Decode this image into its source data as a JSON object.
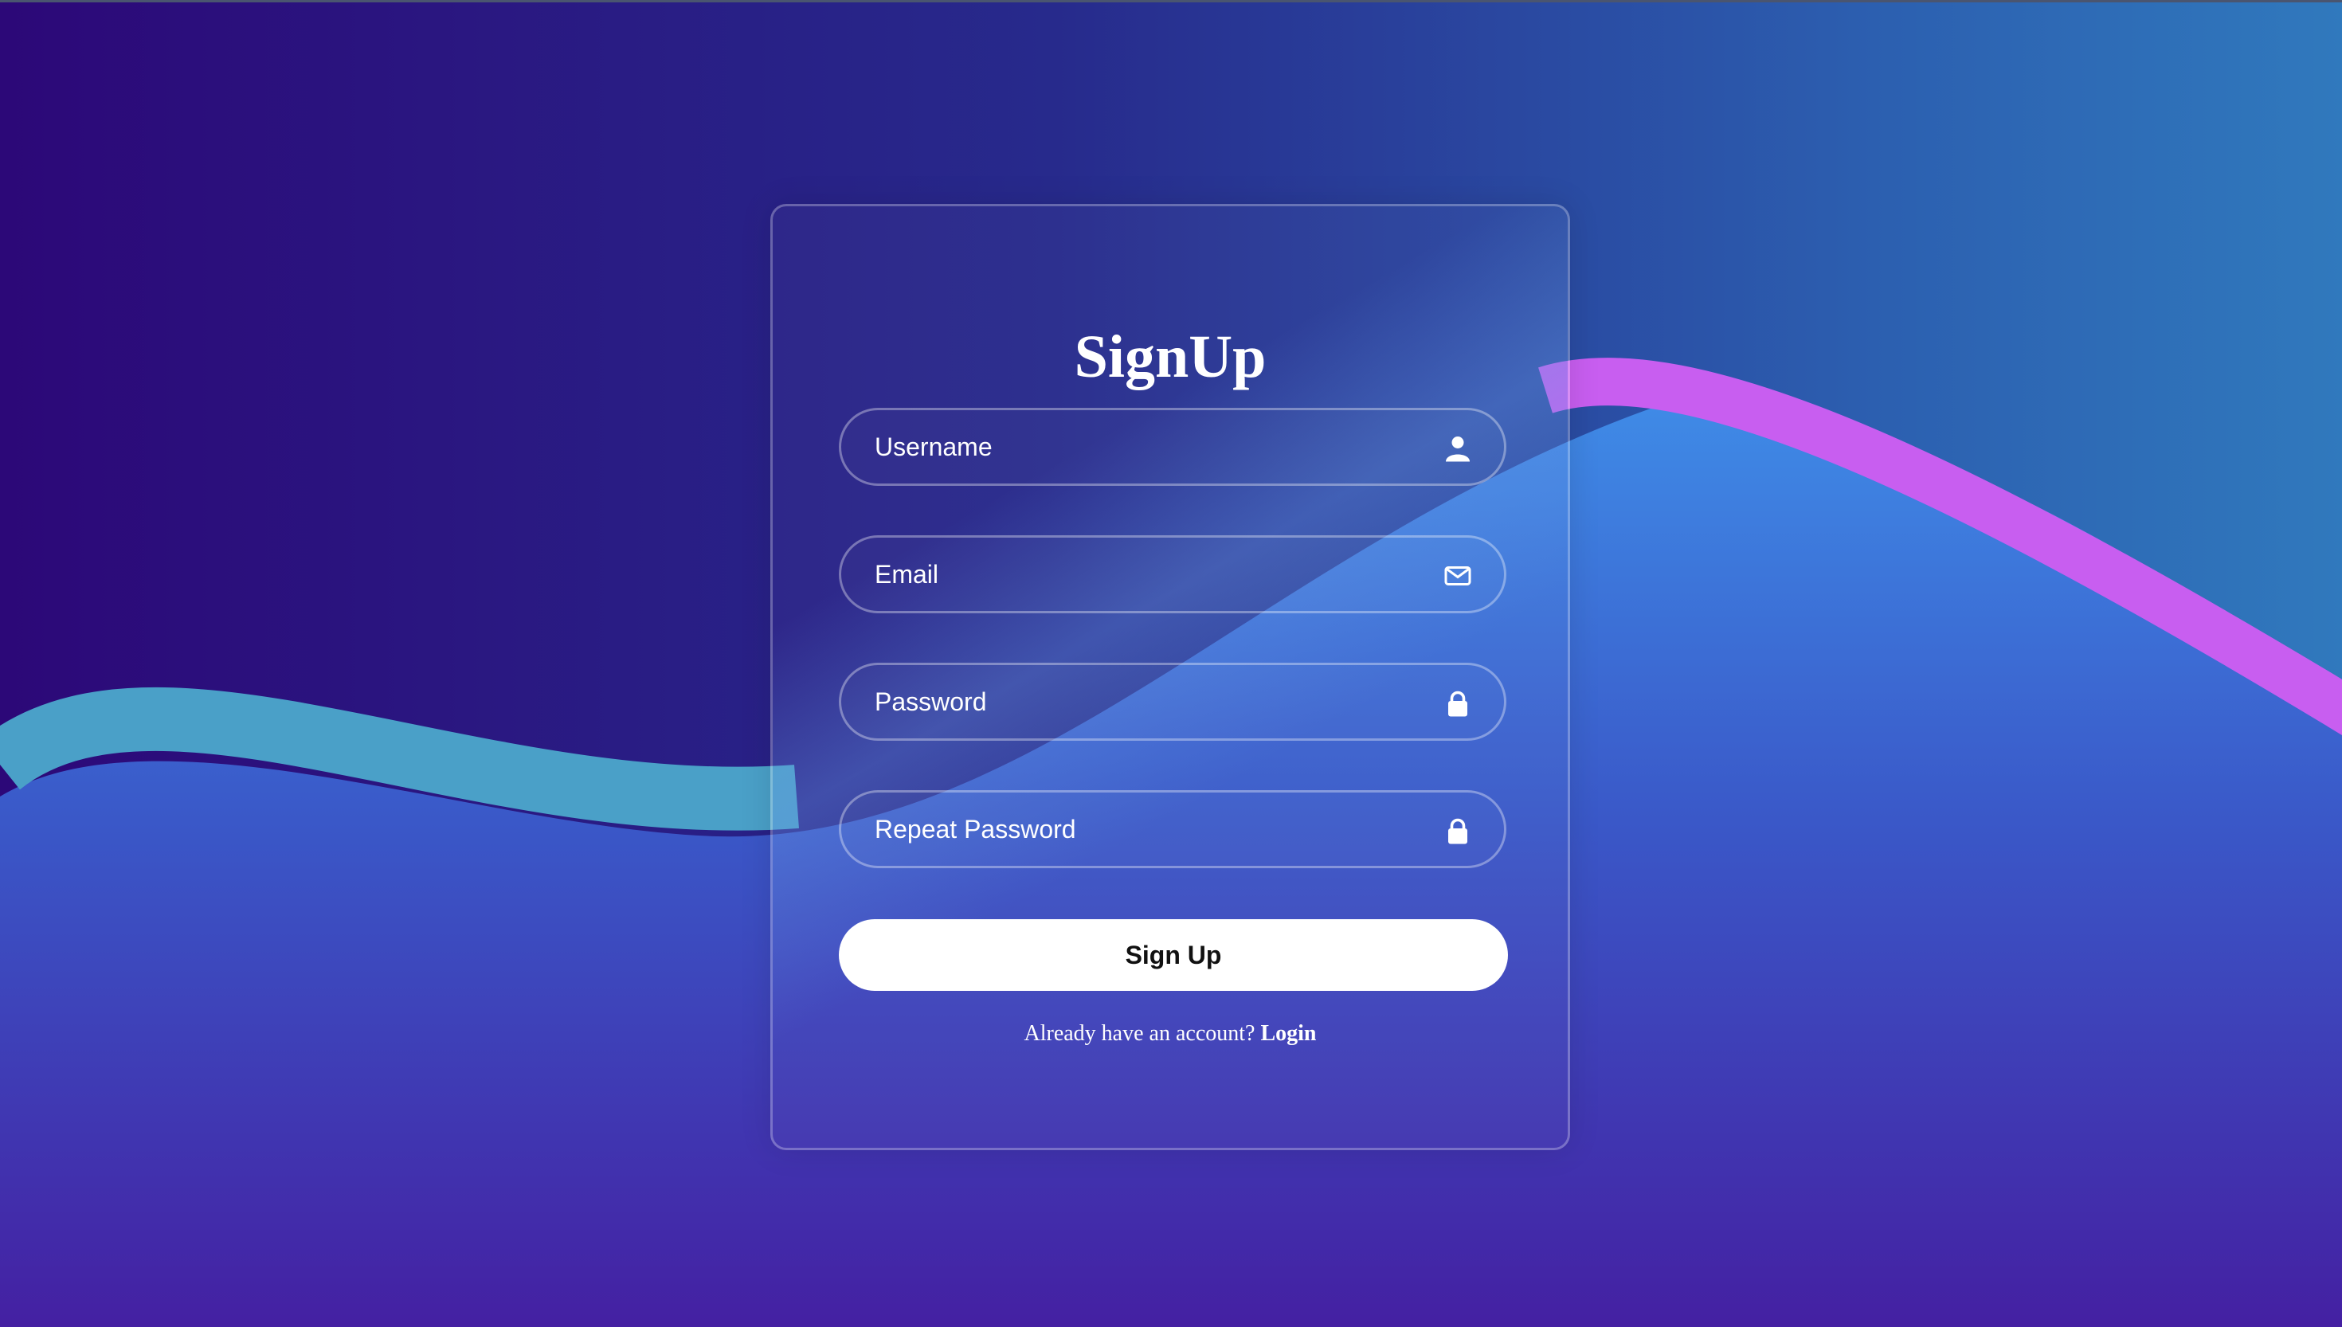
{
  "form": {
    "title": "SignUp",
    "fields": [
      {
        "placeholder": "Username",
        "icon": "user-icon"
      },
      {
        "placeholder": "Email",
        "icon": "mail-icon"
      },
      {
        "placeholder": "Password",
        "icon": "lock-icon"
      },
      {
        "placeholder": "Repeat Password",
        "icon": "lock-icon"
      }
    ],
    "submit_label": "Sign Up",
    "footer_text": "Already have an account? ",
    "login_label": "Login"
  },
  "colors": {
    "bg_left": "#2c0878",
    "bg_right": "#3079bd",
    "wave_fill": "#3c6fd8",
    "wave_teal": "#4aa0c8",
    "wave_pink": "#c85ef0",
    "text": "#ffffff",
    "button_bg": "#ffffff",
    "button_text": "#111111"
  }
}
